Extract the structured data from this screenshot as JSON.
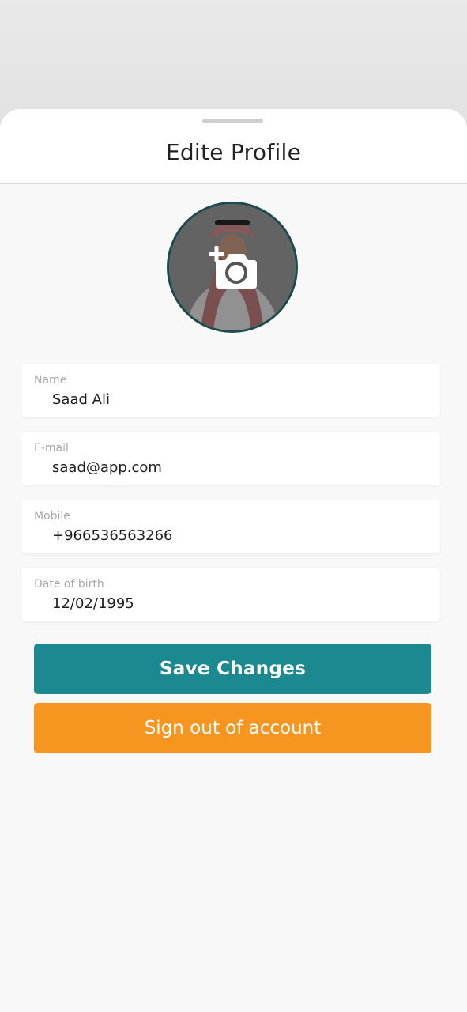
{
  "header": {
    "title": "Edite Profile"
  },
  "profile": {
    "avatar_icon": "person-photo",
    "camera_icon": "add-photo-icon"
  },
  "fields": [
    {
      "label": "Name",
      "value": "Saad Ali"
    },
    {
      "label": "E-mail",
      "value": "saad@app.com"
    },
    {
      "label": "Mobile",
      "value": "+966536563266"
    },
    {
      "label": "Date of birth",
      "value": "12/02/1995"
    }
  ],
  "actions": {
    "save_label": "Save Changes",
    "signout_label": "Sign out of account"
  },
  "colors": {
    "primary": "#1c8890",
    "signout": "#f69520",
    "avatar_ring": "#1b4b4d"
  }
}
